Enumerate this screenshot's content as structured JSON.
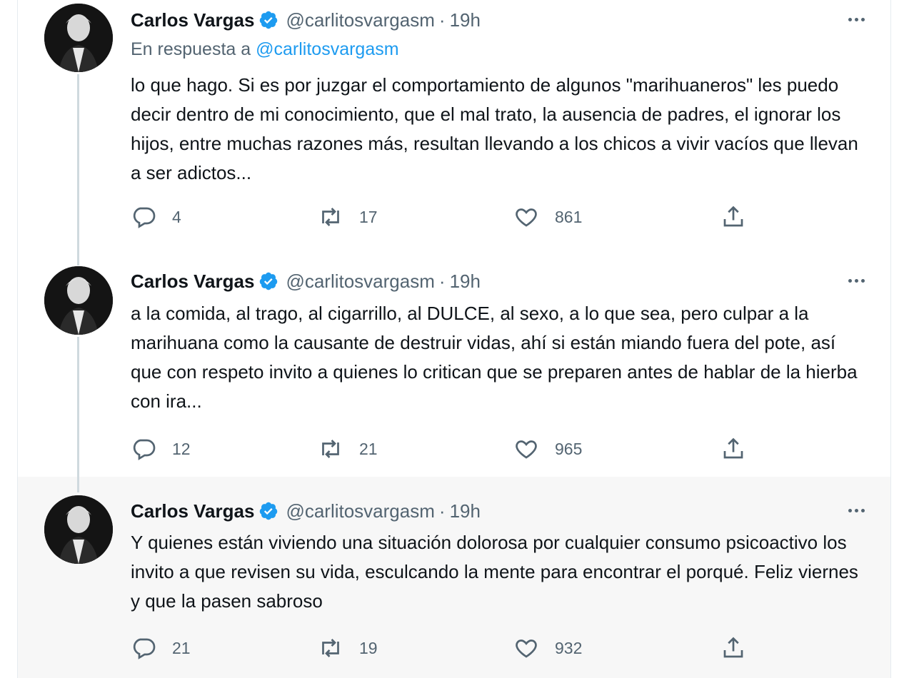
{
  "tweets": [
    {
      "author_name": "Carlos Vargas",
      "handle": "@carlitosvargasm",
      "separator": "·",
      "time": "19h",
      "reply_prefix": "En respuesta a",
      "reply_to": "@carlitosvargasm",
      "text": "lo que hago. Si es por juzgar el comportamiento de algunos \"marihuaneros\" les puedo decir dentro de mi conocimiento, que el mal trato, la ausencia de padres, el ignorar los hijos, entre muchas razones más, resultan llevando a los chicos a vivir vacíos que llevan a ser adictos...",
      "replies": "4",
      "retweets": "17",
      "likes": "861"
    },
    {
      "author_name": "Carlos Vargas",
      "handle": "@carlitosvargasm",
      "separator": "·",
      "time": "19h",
      "text": "a la comida, al trago, al cigarrillo, al DULCE, al sexo, a lo que sea, pero culpar a la marihuana como la causante de destruir vidas, ahí si están miando fuera del pote, así que con respeto invito a quienes lo critican que se preparen antes de hablar de la hierba con ira...",
      "replies": "12",
      "retweets": "21",
      "likes": "965"
    },
    {
      "author_name": "Carlos Vargas",
      "handle": "@carlitosvargasm",
      "separator": "·",
      "time": "19h",
      "text": "Y quienes están viviendo una situación dolorosa por cualquier consumo psicoactivo los invito a que revisen su vida, esculcando la mente para encontrar el porqué. Feliz viernes y que la pasen sabroso",
      "replies": "21",
      "retweets": "19",
      "likes": "932"
    }
  ],
  "icons": {
    "reply": "reply-icon",
    "retweet": "retweet-icon",
    "like": "like-icon",
    "share": "share-icon",
    "more": "more-icon",
    "verified": "verified-badge-icon"
  },
  "colors": {
    "accent": "#1d9bf0",
    "secondary_text": "#536471",
    "thread_line": "#cfd9de",
    "highlight_bg": "#f7f7f7"
  }
}
